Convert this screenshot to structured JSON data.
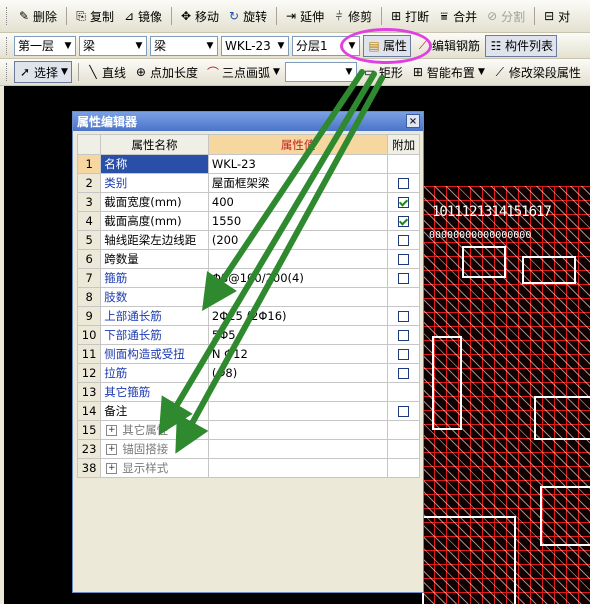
{
  "toolbar1": {
    "delete": "删除",
    "copy": "复制",
    "mirror": "镜像",
    "move": "移动",
    "rotate": "旋转",
    "extend": "延伸",
    "trim": "修剪",
    "break": "打断",
    "merge": "合并",
    "split": "分割",
    "align_partial": "对"
  },
  "toolbar2": {
    "floor": "第一层",
    "category1": "梁",
    "category2": "梁",
    "element": "WKL-23",
    "layer": "分层1",
    "properties": "属性",
    "edit_rebar": "编辑钢筋",
    "element_list": "构件列表"
  },
  "toolbar3": {
    "select": "选择",
    "line": "直线",
    "point_length": "点加长度",
    "three_point_arc": "三点画弧",
    "rect": "矩形",
    "smart_layout": "智能布置",
    "modify_span_partial": "修改梁段属性"
  },
  "canvas": {
    "axis_labels": "1011121314151617",
    "axis_zeros": "00000000000000000"
  },
  "dialog": {
    "title": "属性编辑器",
    "close": "×",
    "headers": {
      "num": "",
      "name": "属性名称",
      "value": "属性值",
      "add": "附加"
    },
    "rows": [
      {
        "num": "1",
        "name": "名称",
        "value": "WKL-23",
        "checkbox": "none",
        "blue": true,
        "selected": true
      },
      {
        "num": "2",
        "name": "类别",
        "value": "屋面框架梁",
        "checkbox": "off",
        "blue": true
      },
      {
        "num": "3",
        "name": "截面宽度(mm)",
        "value": "400",
        "checkbox": "on",
        "blue": false
      },
      {
        "num": "4",
        "name": "截面高度(mm)",
        "value": "1550",
        "checkbox": "on",
        "blue": false
      },
      {
        "num": "5",
        "name": "轴线距梁左边线距",
        "value": "(200",
        "checkbox": "off",
        "blue": false
      },
      {
        "num": "6",
        "name": "跨数量",
        "value": "",
        "checkbox": "off",
        "blue": false
      },
      {
        "num": "7",
        "name": "箍筋",
        "value": "Φ8@100/200(4)",
        "checkbox": "off",
        "blue": true
      },
      {
        "num": "8",
        "name": "肢数",
        "value": "4",
        "checkbox": "none",
        "blue": true
      },
      {
        "num": "9",
        "name": "上部通长筋",
        "value": "2Φ25 (2Φ16)",
        "checkbox": "off",
        "blue": true
      },
      {
        "num": "10",
        "name": "下部通长筋",
        "value": "5Φ5",
        "checkbox": "off",
        "blue": true
      },
      {
        "num": "11",
        "name": "侧面构造或受扭",
        "value": "N Φ12",
        "checkbox": "off",
        "blue": true
      },
      {
        "num": "12",
        "name": "拉筋",
        "value": "(Φ8)",
        "checkbox": "off",
        "blue": true
      },
      {
        "num": "13",
        "name": "其它箍筋",
        "value": "",
        "checkbox": "none",
        "blue": true
      },
      {
        "num": "14",
        "name": "备注",
        "value": "",
        "checkbox": "off",
        "blue": false
      },
      {
        "num": "15",
        "name": "其它属性",
        "value": "",
        "checkbox": "none",
        "group": true
      },
      {
        "num": "23",
        "name": "锚固搭接",
        "value": "",
        "checkbox": "none",
        "group": true
      },
      {
        "num": "38",
        "name": "显示样式",
        "value": "",
        "checkbox": "none",
        "group": true
      }
    ]
  },
  "colors": {
    "annotation_circle": "#e040e0",
    "arrow": "#2f8a2f",
    "selected_row": "#2a4fa8",
    "grid_line": "#e01818"
  }
}
